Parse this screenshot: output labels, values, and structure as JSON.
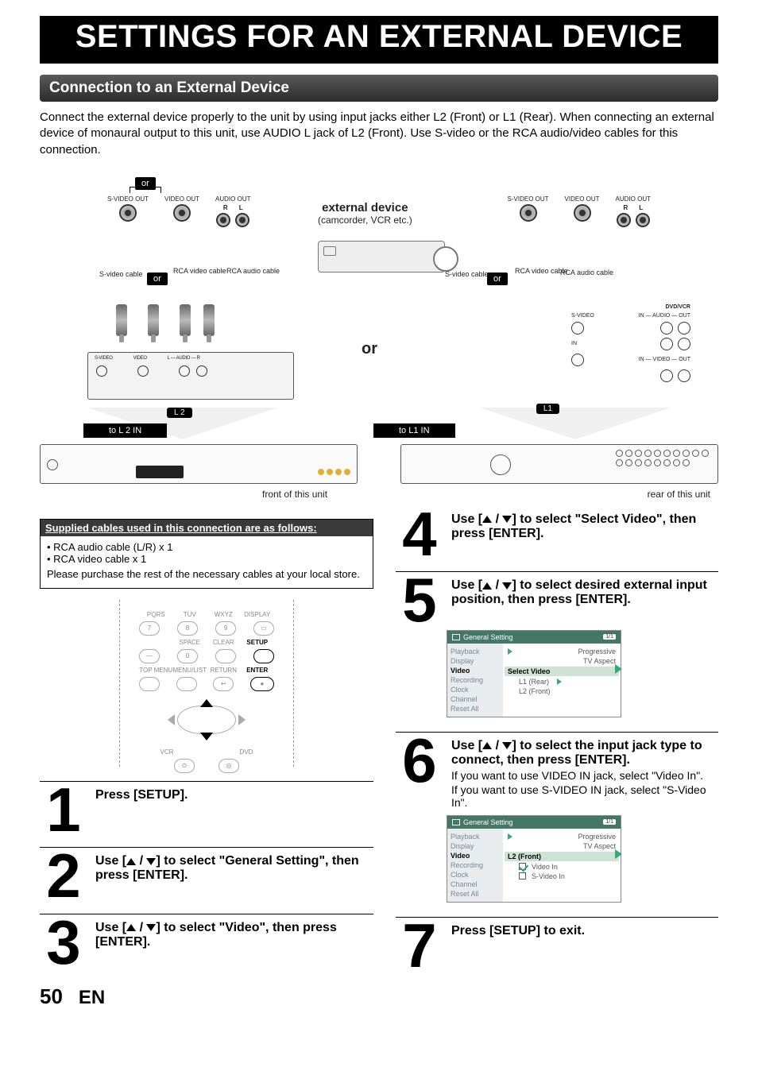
{
  "title": "SETTINGS FOR AN EXTERNAL DEVICE",
  "section_header": "Connection to an External Device",
  "intro": "Connect the external device properly to the unit by using input jacks either L2 (Front) or L1 (Rear). When connecting an external device of monaural output to this unit, use AUDIO L jack of L2 (Front). Use S-video or the RCA audio/video cables for this connection.",
  "diagram": {
    "or_label": "or",
    "svideo_out": "S-VIDEO\nOUT",
    "video_out": "VIDEO\nOUT",
    "audio_out": "AUDIO OUT",
    "r": "R",
    "l": "L",
    "external_device": "external device",
    "external_device_sub": "(camcorder, VCR etc.)",
    "svideo_cable": "S-video\ncable",
    "rca_video_cable": "RCA\nvideo\ncable",
    "rca_audio_cable": "RCA\naudio\ncable",
    "rca_audio_cable2": "RCA\naudio cable",
    "big_or": "or",
    "front_jacks": {
      "svideo": "S-VIDEO",
      "video": "VIDEO",
      "audio_l": "L — AUDIO — R"
    },
    "rear_jacks": {
      "header": "DVD/VCR",
      "svideo": "S-VIDEO",
      "in": "IN",
      "audio_in_out": "IN — AUDIO — OUT",
      "video_in_out": "IN — VIDEO — OUT"
    },
    "l2_badge": "L 2",
    "l1_badge": "L1",
    "to_l2": "to L 2 IN",
    "to_l1": "to L1 IN",
    "front_caption": "front of this unit",
    "rear_caption": "rear of this unit"
  },
  "supplied": {
    "header": "Supplied cables used in this connection are as follows:",
    "items": [
      "RCA audio cable (L/R) x 1",
      "RCA video cable x 1"
    ],
    "note": "Please purchase the rest of the necessary cables at your local store."
  },
  "remote": {
    "row1": [
      "PQRS",
      "TUV",
      "WXYZ",
      "DISPLAY"
    ],
    "keys1": [
      "7",
      "8",
      "9"
    ],
    "row2": [
      "",
      "SPACE",
      "CLEAR",
      "SETUP"
    ],
    "keys2": [
      "",
      "0",
      ""
    ],
    "row3": [
      "TOP MENU",
      "MENU/LIST",
      "RETURN",
      "ENTER"
    ],
    "bottom": [
      "VCR",
      "DVD"
    ]
  },
  "steps": {
    "s1": "Press [SETUP].",
    "s2": "Use [▲ / ▼] to select \"General Setting\", then press [ENTER].",
    "s3": "Use [▲ / ▼] to select \"Video\", then press [ENTER].",
    "s4": "Use [▲ / ▼] to select \"Select Video\", then press [ENTER].",
    "s5": "Use [▲ / ▼] to select desired external input position, then press [ENTER].",
    "s6_a": "Use [▲ / ▼] to select the input jack type to connect, then press [ENTER].",
    "s6_b": "If you want to use VIDEO IN jack, select \"Video In\".",
    "s6_c": " If you want to use S-VIDEO IN jack, select \"S-Video In\".",
    "s7": "Press [SETUP] to exit."
  },
  "osd": {
    "title": "General Setting",
    "tag": "1/1",
    "side": [
      "Playback",
      "Display",
      "Video",
      "Recording",
      "Clock",
      "Channel",
      "Reset All"
    ],
    "side_selected_index": 2,
    "menu5": {
      "rows": [
        "Progressive",
        "TV Aspect",
        "Select Video",
        "L1 (Rear)",
        "L2 (Front)"
      ],
      "highlight": "Select Video"
    },
    "menu6": {
      "rows": [
        "Progressive",
        "TV Aspect",
        "L2 (Front)",
        "Video In",
        "S-Video In"
      ],
      "highlight": "L2 (Front)"
    }
  },
  "footer": {
    "page": "50",
    "lang": "EN"
  }
}
